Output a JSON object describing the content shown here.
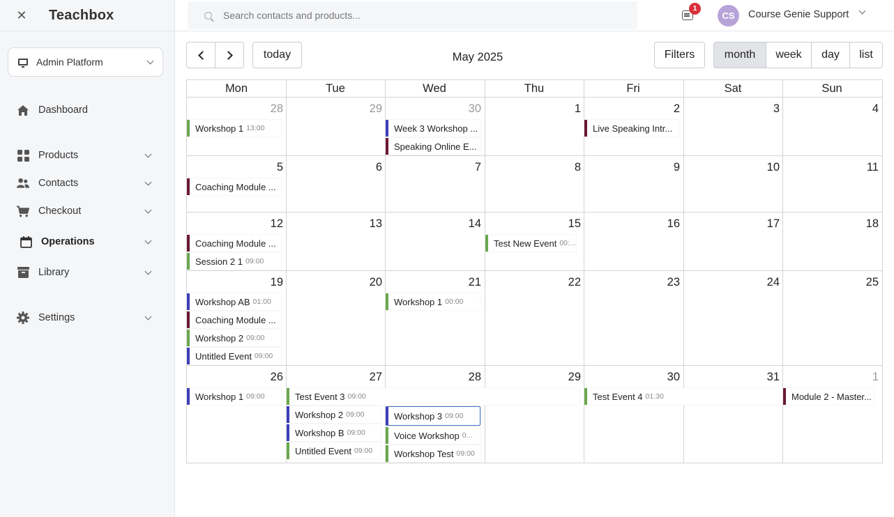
{
  "sidebar": {
    "brand": "Teachbox",
    "platform": "Admin Platform",
    "items": [
      {
        "label": "Dashboard"
      },
      {
        "label": "Products"
      },
      {
        "label": "Contacts"
      },
      {
        "label": "Checkout"
      },
      {
        "label": "Operations"
      },
      {
        "label": "Library"
      },
      {
        "label": "Settings"
      }
    ]
  },
  "topbar": {
    "search_placeholder": "Search contacts and products...",
    "notification_count": "1",
    "avatar_initials": "CS",
    "user_name": "Course Genie Support"
  },
  "toolbar": {
    "today": "today",
    "title": "May 2025",
    "filters": "Filters",
    "views": [
      "month",
      "week",
      "day",
      "list"
    ],
    "active_view": "month"
  },
  "calendar": {
    "weekdays": [
      "Mon",
      "Tue",
      "Wed",
      "Thu",
      "Fri",
      "Sat",
      "Sun"
    ],
    "weeks": [
      [
        "28",
        "29",
        "30",
        "1",
        "2",
        "3",
        "4"
      ],
      [
        "5",
        "6",
        "7",
        "8",
        "9",
        "10",
        "11"
      ],
      [
        "12",
        "13",
        "14",
        "15",
        "16",
        "17",
        "18"
      ],
      [
        "19",
        "20",
        "21",
        "22",
        "23",
        "24",
        "25"
      ],
      [
        "26",
        "27",
        "28",
        "29",
        "30",
        "31",
        "1"
      ]
    ],
    "colors": {
      "green": "#6aa84f",
      "blue": "#3d3fb8",
      "maroon": "#6b1a33"
    },
    "events": {
      "w0_mon_1": {
        "name": "Workshop 1",
        "time": "13:00"
      },
      "w0_wed_1": {
        "name": "Week 3 Workshop ...",
        "time": ""
      },
      "w0_wed_2": {
        "name": "Speaking Online E...",
        "time": ""
      },
      "w0_fri_1": {
        "name": "Live Speaking Intr...",
        "time": ""
      },
      "w1_mon_1": {
        "name": "Coaching Module ...",
        "time": ""
      },
      "w2_mon_1": {
        "name": "Coaching Module ...",
        "time": ""
      },
      "w2_mon_2": {
        "name": "Session 2 1",
        "time": "09:00"
      },
      "w2_thu_1": {
        "name": "Test New Event",
        "time": "00:..."
      },
      "w3_mon_1": {
        "name": "Workshop AB",
        "time": "01:00"
      },
      "w3_mon_2": {
        "name": "Coaching Module ...",
        "time": ""
      },
      "w3_mon_3": {
        "name": "Workshop 2",
        "time": "09:00"
      },
      "w3_mon_4": {
        "name": "Untitled Event",
        "time": "09:00"
      },
      "w3_wed_1": {
        "name": "Workshop 1",
        "time": "00:00"
      },
      "w4_mon_1": {
        "name": "Workshop 1",
        "time": "09:00"
      },
      "w4_tue_1": {
        "name": "Test Event 3",
        "time": "09:00"
      },
      "w4_tue_2": {
        "name": "Workshop 2",
        "time": "09:00"
      },
      "w4_tue_3": {
        "name": "Workshop B",
        "time": "09:00"
      },
      "w4_tue_4": {
        "name": "Untitled Event",
        "time": "09:00"
      },
      "w4_wed_1": {
        "name": "Workshop 3",
        "time": "09:00"
      },
      "w4_wed_2": {
        "name": "Voice Workshop",
        "time": "0..."
      },
      "w4_wed_3": {
        "name": "Workshop Test",
        "time": "09:00"
      },
      "w4_fri_1": {
        "name": "Test Event 4",
        "time": "01:30"
      },
      "w4_sun_1": {
        "name": "Module 2 - Master...",
        "time": ""
      }
    }
  }
}
